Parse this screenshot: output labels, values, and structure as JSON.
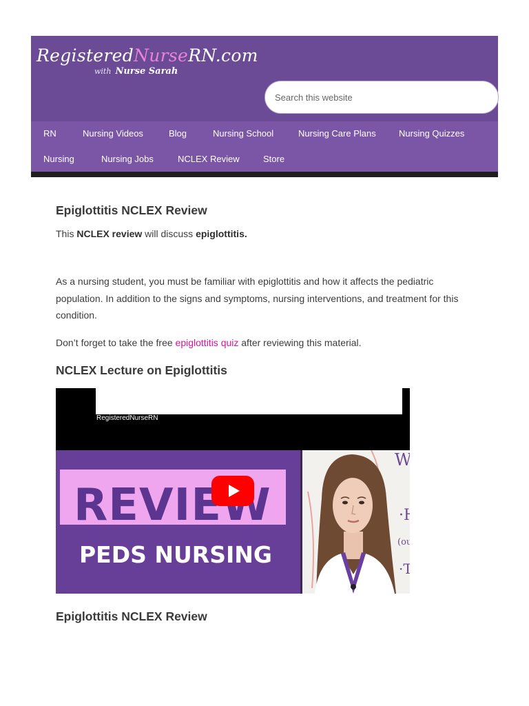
{
  "header": {
    "logo": {
      "part1": "Registered",
      "part2": "Nurse",
      "part3": "RN.com",
      "with": "with",
      "name": "Nurse Sarah"
    },
    "search_placeholder": "Search this website"
  },
  "nav": {
    "row1": [
      "RN",
      "Nursing Videos",
      "Blog",
      "Nursing School",
      "Nursing Care Plans",
      "Nursing Quizzes"
    ],
    "row2": [
      "Nursing",
      "Nursing Jobs",
      "NCLEX Review",
      "Store"
    ]
  },
  "article": {
    "title": "Epiglottitis NCLEX Review",
    "intro": {
      "pre": "This ",
      "b1": "NCLEX review",
      "mid": " will discuss ",
      "b2": "epiglottitis."
    },
    "para1": "As a nursing student, you must be familiar with epiglottitis and how it affects the pediatric population. In addition to the signs and symptoms, nursing interventions, and treatment for this condition.",
    "para2": {
      "pre": "Don’t forget to take the free ",
      "link": "epiglottitis quiz",
      "post": " after reviewing this material."
    },
    "lecture_heading": "NCLEX Lecture on Epiglottitis",
    "video": {
      "channel": "RegisteredNurseRN",
      "thumb_title": "REVIEW",
      "thumb_subtitle": "PEDS NURSING"
    },
    "section_heading": "Epiglottitis NCLEX Review"
  },
  "colors": {
    "header_bg": "#6b4a96",
    "nav_bg": "#7b56a6",
    "link": "#e0119a",
    "play": "#ff0000"
  }
}
